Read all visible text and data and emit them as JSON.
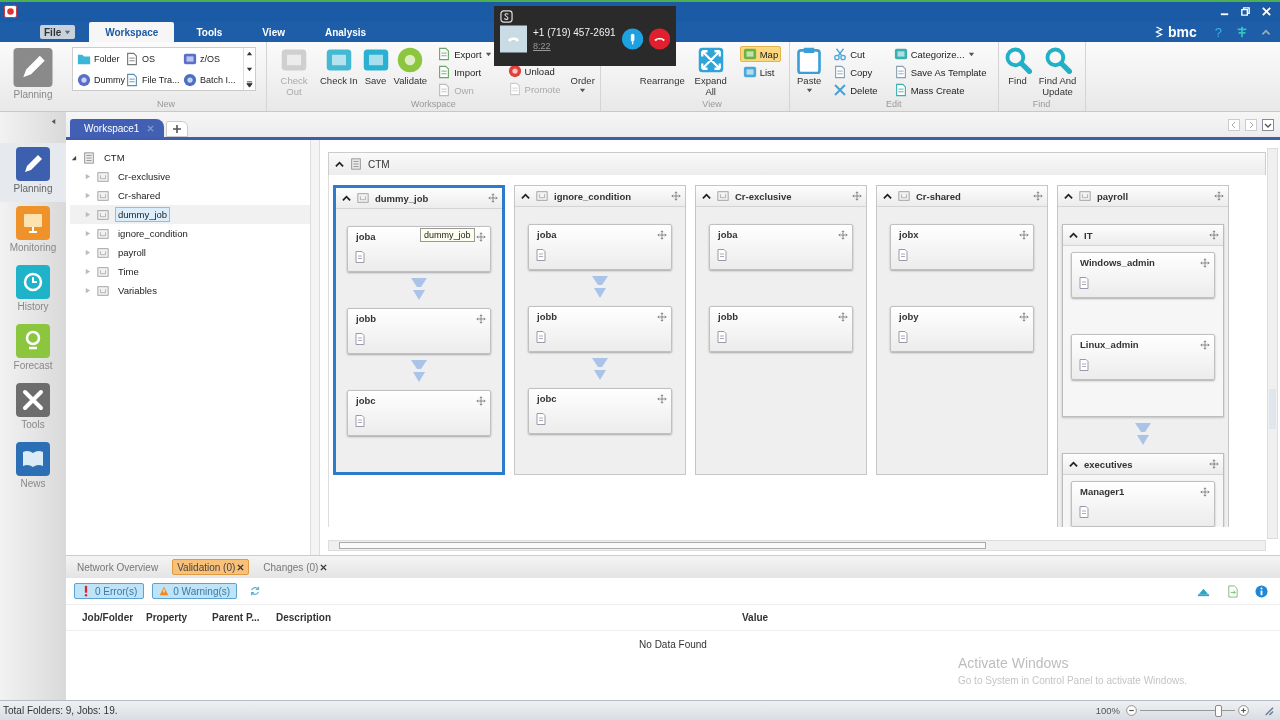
{
  "menu_tabs": [
    {
      "label": "File",
      "kind": "file",
      "selected": false
    },
    {
      "label": "Workspace",
      "kind": "tab",
      "selected": true
    },
    {
      "label": "Tools",
      "kind": "tab",
      "selected": false
    },
    {
      "label": "View",
      "kind": "tab",
      "selected": false
    },
    {
      "label": "Analysis",
      "kind": "tab",
      "selected": false
    }
  ],
  "brand": {
    "logo": "bmc",
    "help": "?"
  },
  "call_window": {
    "number": "+1 (719) 457-2691",
    "duration": "8:22"
  },
  "ribbon": {
    "mode": {
      "label": "Planning"
    },
    "groups": [
      {
        "title": "New",
        "kind": "gallery",
        "items": [
          "Folder",
          "OS",
          "z/OS",
          "Dummy",
          "File Tra...",
          "Batch I..."
        ]
      },
      {
        "title": "Workspace",
        "kind": "buttons",
        "items": [
          {
            "kind": "large",
            "label": "Check Out",
            "disabled": true,
            "dropdown": false
          },
          {
            "kind": "large",
            "label": "Check In",
            "disabled": false,
            "dropdown": false
          },
          {
            "kind": "large",
            "label": "Save",
            "disabled": false,
            "dropdown": false
          },
          {
            "kind": "large",
            "label": "Validate",
            "disabled": false,
            "dropdown": false
          },
          {
            "kind": "small",
            "label": "Export",
            "disabled": false,
            "dropdown": true
          },
          {
            "kind": "small",
            "label": "Import",
            "disabled": false,
            "dropdown": false
          },
          {
            "kind": "small",
            "label": "Own",
            "disabled": true,
            "dropdown": false
          },
          {
            "kind": "small",
            "label": "Unload",
            "disabled": false,
            "dropdown": false
          },
          {
            "kind": "small",
            "label": "Promote",
            "disabled": true,
            "dropdown": false
          },
          {
            "kind": "large",
            "label": "Order",
            "disabled": false,
            "dropdown": true
          }
        ]
      },
      {
        "title": "View",
        "kind": "buttons",
        "items": [
          {
            "kind": "large",
            "label": "Rearrange",
            "disabled": false,
            "dropdown": false
          },
          {
            "kind": "large",
            "label": "Expand All",
            "disabled": false,
            "dropdown": false
          },
          {
            "kind": "small",
            "label": "Map",
            "disabled": false,
            "dropdown": false,
            "selected": true
          },
          {
            "kind": "small",
            "label": "List",
            "disabled": false,
            "dropdown": false,
            "selected": false
          }
        ]
      },
      {
        "title": "Edit",
        "kind": "buttons",
        "items": [
          {
            "kind": "large",
            "label": "Paste",
            "disabled": false,
            "dropdown": true
          },
          {
            "kind": "small",
            "label": "Cut",
            "disabled": false,
            "dropdown": false
          },
          {
            "kind": "small",
            "label": "Copy",
            "disabled": false,
            "dropdown": false
          },
          {
            "kind": "small",
            "label": "Delete",
            "disabled": false,
            "dropdown": false
          },
          {
            "kind": "small",
            "label": "Categorize...",
            "disabled": false,
            "dropdown": true
          },
          {
            "kind": "small",
            "label": "Save As Template",
            "disabled": false,
            "dropdown": false
          },
          {
            "kind": "small",
            "label": "Mass Create",
            "disabled": false,
            "dropdown": false
          }
        ]
      },
      {
        "title": "Find",
        "kind": "buttons",
        "items": [
          {
            "kind": "large",
            "label": "Find",
            "disabled": false,
            "dropdown": false
          },
          {
            "kind": "large",
            "label": "Find And Update",
            "disabled": false,
            "dropdown": false
          }
        ]
      }
    ]
  },
  "workspace_tabs": [
    {
      "label": "Workspace1",
      "selected": true
    }
  ],
  "nav": [
    {
      "label": "Planning",
      "selected": true
    },
    {
      "label": "Monitoring",
      "selected": false
    },
    {
      "label": "History",
      "selected": false
    },
    {
      "label": "Forecast",
      "selected": false
    },
    {
      "label": "Tools",
      "selected": false
    },
    {
      "label": "News",
      "selected": false
    }
  ],
  "tree": {
    "label": "CTM",
    "expanded": true,
    "children": [
      {
        "label": "Cr-exclusive",
        "expanded": false,
        "selected": false
      },
      {
        "label": "Cr-shared",
        "expanded": false,
        "selected": false
      },
      {
        "label": "dummy_job",
        "expanded": false,
        "selected": true
      },
      {
        "label": "ignore_condition",
        "expanded": false,
        "selected": false
      },
      {
        "label": "payroll",
        "expanded": false,
        "selected": false
      },
      {
        "label": "Time",
        "expanded": false,
        "selected": false
      },
      {
        "label": "Variables",
        "expanded": false,
        "selected": false
      }
    ]
  },
  "map": {
    "title": "CTM",
    "folders": [
      {
        "name": "dummy_job",
        "selected": true,
        "children": [
          {
            "kind": "job",
            "name": "joba",
            "arrow_below": true,
            "tooltip": "dummy_job"
          },
          {
            "kind": "job",
            "name": "jobb",
            "arrow_below": true
          },
          {
            "kind": "job",
            "name": "jobc",
            "arrow_below": false
          }
        ]
      },
      {
        "name": "ignore_condition",
        "selected": false,
        "children": [
          {
            "kind": "job",
            "name": "joba",
            "arrow_below": true
          },
          {
            "kind": "job",
            "name": "jobb",
            "arrow_below": true
          },
          {
            "kind": "job",
            "name": "jobc",
            "arrow_below": false
          }
        ]
      },
      {
        "name": "Cr-exclusive",
        "selected": false,
        "children": [
          {
            "kind": "job",
            "name": "joba",
            "arrow_below": false
          },
          {
            "kind": "job",
            "name": "jobb",
            "arrow_below": false
          }
        ]
      },
      {
        "name": "Cr-shared",
        "selected": false,
        "children": [
          {
            "kind": "job",
            "name": "jobx",
            "arrow_below": false
          },
          {
            "kind": "job",
            "name": "joby",
            "arrow_below": false
          }
        ]
      },
      {
        "name": "payroll",
        "selected": false,
        "children": [
          {
            "kind": "folder",
            "name": "IT",
            "arrow_below": true,
            "children": [
              {
                "kind": "job",
                "name": "Windows_admin",
                "arrow_below": false
              },
              {
                "kind": "job",
                "name": "Linux_admin",
                "arrow_below": false
              }
            ]
          },
          {
            "kind": "folder",
            "name": "executives",
            "arrow_below": false,
            "children": [
              {
                "kind": "job",
                "name": "Manager1",
                "arrow_below": false
              }
            ]
          }
        ]
      }
    ]
  },
  "bottom_tabs": [
    {
      "label": "Network Overview",
      "selected": false,
      "closable": false
    },
    {
      "label": "Validation (0)",
      "selected": true,
      "closable": true
    },
    {
      "label": "Changes (0)",
      "selected": false,
      "closable": true
    }
  ],
  "filters": [
    {
      "label": "0 Error(s)",
      "kind": "error",
      "selected": true
    },
    {
      "label": "0 Warning(s)",
      "kind": "warning",
      "selected": true
    }
  ],
  "table": {
    "columns": [
      "Job/Folder",
      "Property",
      "Parent P...",
      "Description",
      "Value"
    ],
    "empty": "No Data Found"
  },
  "os_notice": {
    "title": "Activate Windows",
    "text": "Go to System in Control Panel to activate Windows."
  },
  "status_bar": {
    "text": "Total Folders: 9, Jobs: 19.",
    "zoom": "100%",
    "level": 0.82
  }
}
